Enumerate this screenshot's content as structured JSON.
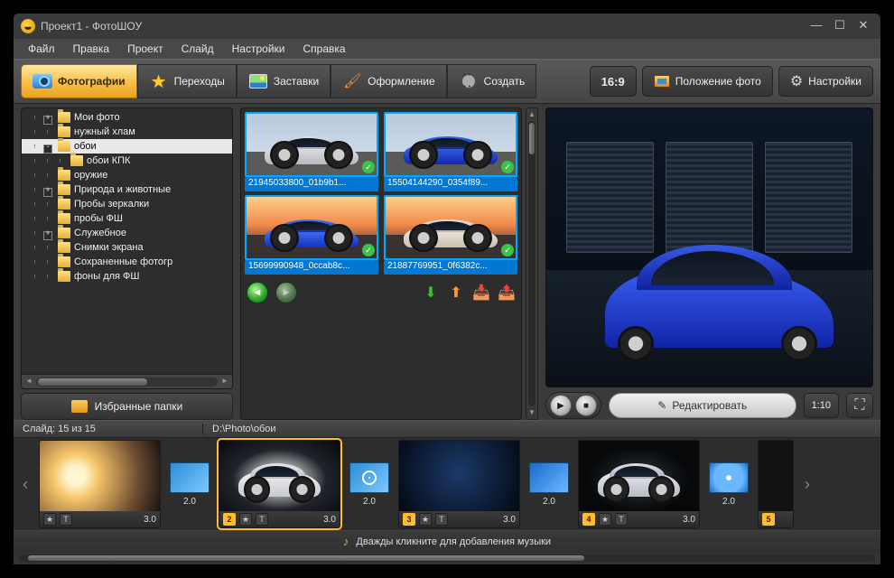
{
  "window": {
    "title": "Проект1 - ФотоШОУ"
  },
  "menu": [
    "Файл",
    "Правка",
    "Проект",
    "Слайд",
    "Настройки",
    "Справка"
  ],
  "tabs": [
    {
      "label": "Фотографии",
      "icon": "camera",
      "active": true
    },
    {
      "label": "Переходы",
      "icon": "star"
    },
    {
      "label": "Заставки",
      "icon": "picture"
    },
    {
      "label": "Оформление",
      "icon": "brush"
    },
    {
      "label": "Создать",
      "icon": "reel"
    }
  ],
  "toolbar_right": {
    "aspect": "16:9",
    "position_label": "Положение фото",
    "settings_label": "Настройки"
  },
  "tree": [
    {
      "indent": 2,
      "tw": "+",
      "label": "Мои фото"
    },
    {
      "indent": 2,
      "tw": "",
      "label": "нужный хлам"
    },
    {
      "indent": 2,
      "tw": "-",
      "label": "обои",
      "selected": true
    },
    {
      "indent": 3,
      "tw": "",
      "label": "обои КПК"
    },
    {
      "indent": 2,
      "tw": "",
      "label": "оружие"
    },
    {
      "indent": 2,
      "tw": "+",
      "label": "Природа и животные"
    },
    {
      "indent": 2,
      "tw": "",
      "label": "Пробы зеркалки"
    },
    {
      "indent": 2,
      "tw": "",
      "label": "пробы ФШ"
    },
    {
      "indent": 2,
      "tw": "+",
      "label": "Служебное"
    },
    {
      "indent": 2,
      "tw": "",
      "label": "Снимки экрана"
    },
    {
      "indent": 2,
      "tw": "",
      "label": "Сохраненные фотогр"
    },
    {
      "indent": 2,
      "tw": "",
      "label": "фоны для ФШ"
    }
  ],
  "favorites_label": "Избранные папки",
  "thumbs": [
    {
      "caption": "21945033800_01b9b1...",
      "scene": "silver-day",
      "checked": true
    },
    {
      "caption": "15504144290_0354f89...",
      "scene": "blue-day",
      "checked": true
    },
    {
      "caption": "15699990948_0ccab8c...",
      "scene": "blue-sunset",
      "checked": true
    },
    {
      "caption": "21887769951_0f6382c...",
      "scene": "silver-sunset",
      "checked": true
    }
  ],
  "preview": {
    "scene": "blue-garage"
  },
  "controls": {
    "edit_label": "Редактировать",
    "time": "1:10"
  },
  "info": {
    "slide_counter": "Слайд: 15 из 15",
    "path": "D:\\Photo\\обои"
  },
  "timeline": {
    "slides": [
      {
        "num": "",
        "scene": "flare",
        "dur": "3.0"
      },
      {
        "num": "2",
        "scene": "white-night",
        "dur": "3.0",
        "sel": true
      },
      {
        "num": "3",
        "scene": "dark-blue",
        "dur": "3.0"
      },
      {
        "num": "4",
        "scene": "black-night",
        "dur": "3.0"
      },
      {
        "num": "5",
        "scene": "cut",
        "dur": ""
      }
    ],
    "transitions": [
      {
        "style": "grid",
        "dur": "2.0"
      },
      {
        "style": "circle",
        "dur": "2.0"
      },
      {
        "style": "wave",
        "dur": "2.0"
      },
      {
        "style": "swirl",
        "dur": "2.0"
      }
    ]
  },
  "music_hint": "Дважды кликните для добавления музыки"
}
